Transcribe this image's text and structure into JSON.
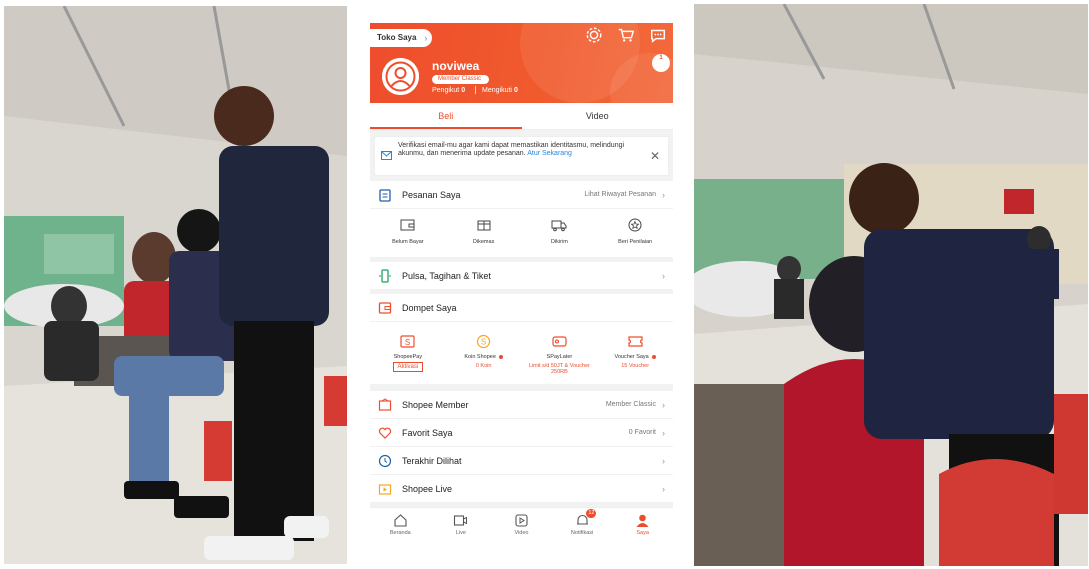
{
  "photos": {
    "left_alt": "",
    "right_alt": ""
  },
  "app": {
    "shop_label": "Toko Saya",
    "notification_count": "1",
    "username": "noviwea",
    "member_tier": "Member Classic",
    "followers_label": "Pengikut",
    "followers_count": "0",
    "following_label": "Mengikuti",
    "following_count": "0",
    "accent_color": "#ee4d2d"
  },
  "tabs": [
    {
      "label": "Beli",
      "active": true
    },
    {
      "label": "Video",
      "active": false
    }
  ],
  "banner": {
    "text": "Verifikasi email-mu agar kami dapat memastikan identitasmu, melindungi akunmu, dan menerima update pesanan.",
    "link": "Atur Sekarang",
    "icon": "envelope-icon"
  },
  "orders": {
    "label": "Pesanan Saya",
    "right": "Lihat Riwayat Pesanan",
    "items": [
      {
        "label": "Belum Bayar",
        "icon": "wallet-icon"
      },
      {
        "label": "Dikemas",
        "icon": "box-icon"
      },
      {
        "label": "Dikirim",
        "icon": "truck-icon"
      },
      {
        "label": "Beri Penilaian",
        "icon": "star-icon"
      }
    ]
  },
  "pulsa": {
    "label": "Pulsa, Tagihan & Tiket",
    "icon": "phone-icon"
  },
  "wallet": {
    "label": "Dompet Saya",
    "items": [
      {
        "label": "ShopeePay",
        "sub": "Aktivasi",
        "icon": "shopeepay-icon"
      },
      {
        "label": "Koin Shopee",
        "sub": "0 Koin",
        "icon": "coin-icon"
      },
      {
        "label": "SPayLater",
        "sub": "Limit s/d 50JT & Voucher 250RB",
        "icon": "paylater-icon"
      },
      {
        "label": "Voucher Saya",
        "sub": "15 Voucher",
        "icon": "voucher-icon"
      }
    ]
  },
  "menu": [
    {
      "label": "Shopee Member",
      "right": "Member Classic",
      "icon": "member-icon"
    },
    {
      "label": "Favorit Saya",
      "right": "0 Favorit",
      "icon": "heart-icon"
    },
    {
      "label": "Terakhir Dilihat",
      "right": "",
      "icon": "clock-icon"
    },
    {
      "label": "Shopee Live",
      "right": "",
      "icon": "live-icon"
    }
  ],
  "bottom_nav": [
    {
      "label": "Beranda",
      "icon": "home-icon",
      "active": false
    },
    {
      "label": "Live",
      "icon": "live-video-icon",
      "active": false
    },
    {
      "label": "Video",
      "icon": "video-icon",
      "active": false
    },
    {
      "label": "Notifikasi",
      "icon": "bell-icon",
      "active": false,
      "badge": "12"
    },
    {
      "label": "Saya",
      "icon": "user-icon",
      "active": true
    }
  ]
}
